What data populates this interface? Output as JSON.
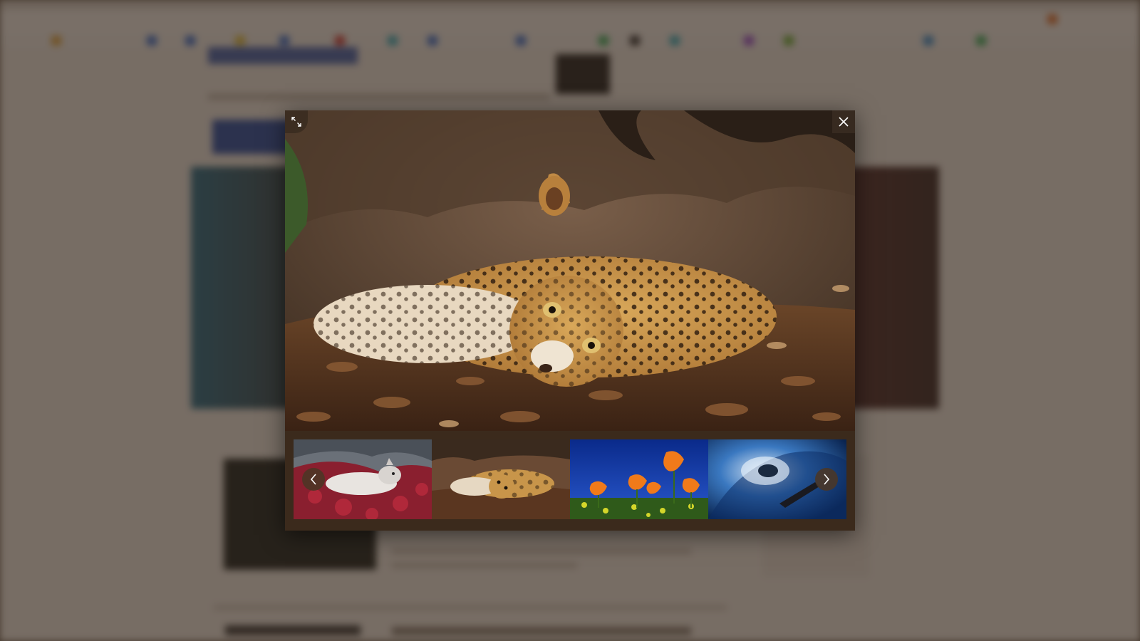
{
  "lightbox": {
    "fullscreen_icon": "expand-icon",
    "close_icon": "close-icon",
    "prev_icon": "chevron-left-icon",
    "next_icon": "chevron-right-icon",
    "active_index": 1,
    "thumbnails": [
      {
        "subject": "wolf"
      },
      {
        "subject": "leopard"
      },
      {
        "subject": "poppies"
      },
      {
        "subject": "wave"
      }
    ]
  },
  "colors": {
    "frame": "#3b2a1c",
    "overlay": "#2d2116",
    "site_title_blue": "#2b4fa8"
  }
}
